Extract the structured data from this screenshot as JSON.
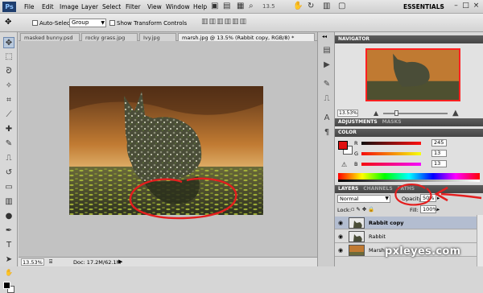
{
  "menubar": {
    "logo": "Ps",
    "items": [
      "File",
      "Edit",
      "Image",
      "Layer",
      "Select",
      "Filter",
      "View",
      "Window",
      "Help"
    ],
    "zoom": "13.5",
    "workspace": "ESSENTIALS"
  },
  "options": {
    "auto_select_label": "Auto-Select:",
    "auto_select_value": "Group",
    "transform_label": "Show Transform Controls"
  },
  "tabs": [
    {
      "label": "masked bunny.psd"
    },
    {
      "label": "rocky grass.jpg"
    },
    {
      "label": "Ivy.jpg"
    },
    {
      "label": "marsh.jpg @ 13.5% (Rabbit copy, RGB/8) *"
    }
  ],
  "status": {
    "zoom": "13.53%",
    "doc": "Doc: 17.2M/62.1M"
  },
  "navigator": {
    "title": "NAVIGATOR",
    "zoom": "13.53%"
  },
  "adjustments": {
    "tabs": [
      "ADJUSTMENTS",
      "MASKS"
    ]
  },
  "color": {
    "title": "COLOR",
    "channels": [
      {
        "label": "R",
        "value": "245"
      },
      {
        "label": "G",
        "value": "13"
      },
      {
        "label": "B",
        "value": "13"
      }
    ],
    "foreground": "#e01010"
  },
  "layers": {
    "tabs": [
      "LAYERS",
      "CHANNELS",
      "PATHS"
    ],
    "blend_mode": "Normal",
    "opacity_label": "Opacity:",
    "opacity_value": "50%",
    "lock_label": "Lock:",
    "fill_label": "Fill:",
    "fill_value": "100%",
    "rows": [
      {
        "name": "Rabbit copy",
        "selected": true
      },
      {
        "name": "Rabbit",
        "selected": false
      },
      {
        "name": "Marsh",
        "selected": false
      }
    ]
  },
  "watermark": "pxleyes.com",
  "colors": {
    "annotation": "#e41e1e",
    "panel_header": "#505050",
    "selected_layer": "#b3bdd0"
  }
}
